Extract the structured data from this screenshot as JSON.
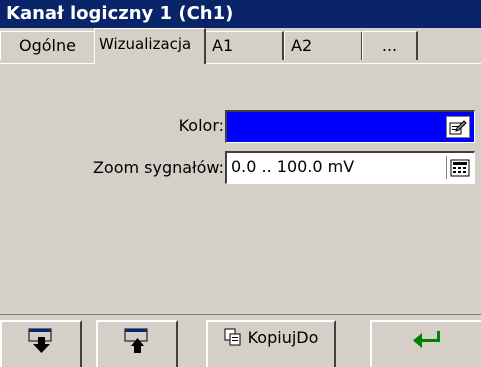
{
  "window": {
    "title": "Kanał logiczny 1 (Ch1)"
  },
  "tabs": [
    {
      "label": "Ogólne"
    },
    {
      "label": "Wizualizacja"
    },
    {
      "label": "A1"
    },
    {
      "label": "A2"
    },
    {
      "label": "..."
    }
  ],
  "active_tab": "Wizualizacja",
  "form": {
    "color_label": "Kolor:",
    "color_value": "C=0, Z=0, N=255",
    "zoom_label": "Zoom sygnałów:",
    "zoom_value": "0.0 .. 100.0 mV"
  },
  "toolbar": {
    "copy_label": "KopiujDo"
  },
  "colors": {
    "title_bg": "#0a246a",
    "selected_field_bg": "#0000ff",
    "enter_arrow": "#008000"
  },
  "icons": [
    "download-icon",
    "upload-icon",
    "copy-icon",
    "enter-icon",
    "edit-icon",
    "keypad-icon"
  ]
}
